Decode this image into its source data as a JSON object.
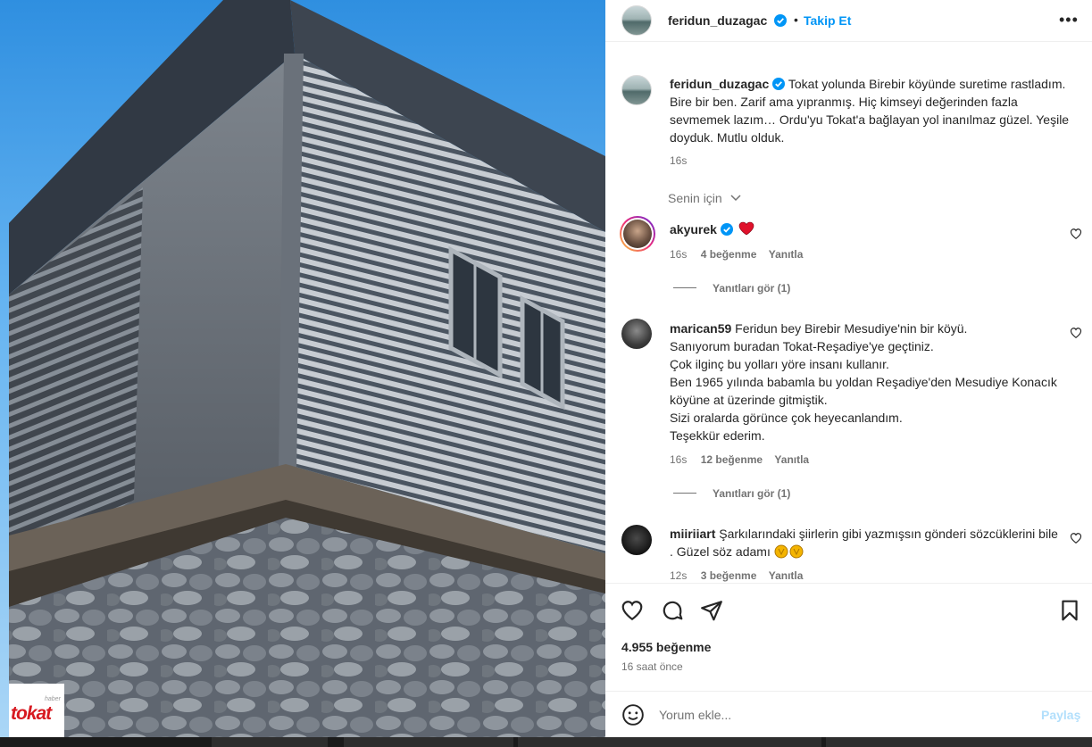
{
  "watermark": {
    "small": "haber",
    "big": "tokat"
  },
  "header": {
    "username": "feridun_duzagac",
    "separator": "•",
    "follow_label": "Takip Et",
    "more_label": "•••"
  },
  "caption": {
    "username": "feridun_duzagac",
    "text": "Tokat yolunda Birebir köyünde suretime rastladım. Bire bir ben. Zarif ama yıpranmış. Hiç kimseyi değerinden fazla sevmemek lazım… Ordu'yu Tokat'a bağlayan yol inanılmaz güzel. Yeşile doyduk. Mutlu olduk.",
    "time": "16s"
  },
  "for_you_label": "Senin için",
  "comments": [
    {
      "username": "akyurek",
      "text": "",
      "time": "16s",
      "likes": "4 beğenme",
      "reply_label": "Yanıtla",
      "view_replies": "Yanıtları gör (1)"
    },
    {
      "username": "marican59",
      "text": "Feridun bey Birebir Mesudiye'nin bir köyü.",
      "lines": [
        "Sanıyorum buradan Tokat-Reşadiye'ye geçtiniz.",
        "Çok ilginç bu yolları yöre insanı kullanır.",
        "Ben 1965 yılında babamla bu yoldan Reşadiye'den Mesudiye Konacık köyüne at üzerinde gitmiştik.",
        "Sizi oralarda görünce çok heyecanlandım.",
        "Teşekkür ederim."
      ],
      "time": "16s",
      "likes": "12 beğenme",
      "reply_label": "Yanıtla",
      "view_replies": "Yanıtları gör (1)"
    },
    {
      "username": "miiriiart",
      "text": "Şarkılarındaki şiirlerin gibi yazmışsın gönderi sözcüklerini bile . Güzel söz adamı",
      "time": "12s",
      "likes": "3 beğenme",
      "reply_label": "Yanıtla"
    }
  ],
  "post": {
    "likes": "4.955 beğenme",
    "time_ago": "16 saat önce"
  },
  "comment_box": {
    "placeholder": "Yorum ekle...",
    "post_label": "Paylaş"
  },
  "colors": {
    "accent": "#0095f6",
    "verified": "#0095f6",
    "heart": "#ed4956",
    "muted": "#737373",
    "text": "#262626"
  },
  "icons": {
    "like": "heart-icon",
    "comment": "comment-icon",
    "share": "send-icon",
    "save": "bookmark-icon",
    "emoji": "emoji-icon",
    "verified": "verified-badge-icon"
  }
}
